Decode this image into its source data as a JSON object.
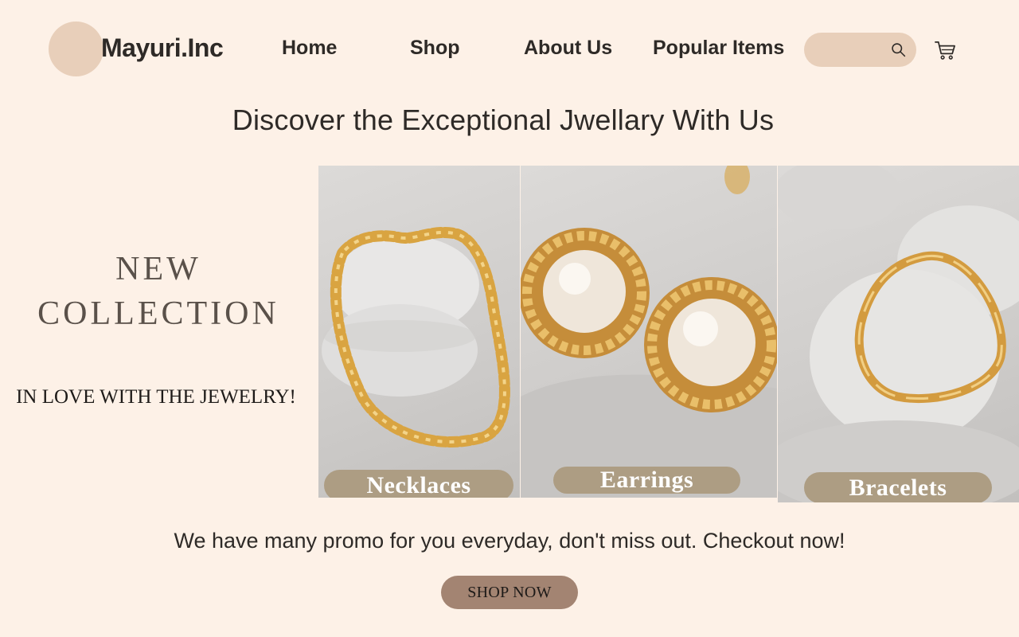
{
  "brand": {
    "name": "Mayuri.Inc"
  },
  "nav": {
    "items": [
      {
        "label": "Home"
      },
      {
        "label": "Shop"
      },
      {
        "label": "About Us"
      },
      {
        "label": "Popular Items"
      }
    ]
  },
  "search": {
    "value": "",
    "placeholder": "",
    "icon": "search-icon"
  },
  "cart": {
    "icon": "cart-icon"
  },
  "hero": {
    "headline": "Discover the Exceptional Jwellary With Us",
    "collection_line1": "NEW",
    "collection_line2": "COLLECTION",
    "tagline": "IN LOVE WITH THE JEWELRY!"
  },
  "products": [
    {
      "label": "Necklaces"
    },
    {
      "label": "Earrings"
    },
    {
      "label": "Bracelets"
    }
  ],
  "promo": {
    "text": "We have many promo for you everyday, don't miss out. Checkout now!",
    "button_label": "SHOP NOW"
  },
  "colors": {
    "background": "#fdf1e7",
    "accent_beige": "#e8cfba",
    "label_pill": "#ad9d83",
    "button": "#a38472",
    "gold": "#d9a441"
  }
}
